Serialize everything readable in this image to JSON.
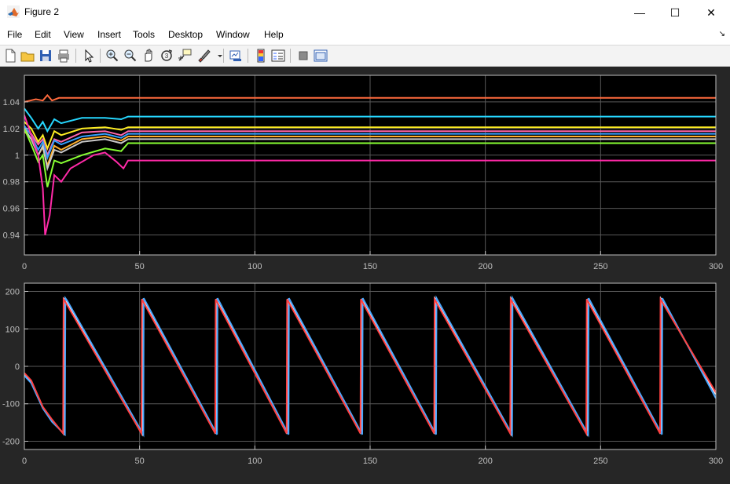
{
  "window": {
    "title": "Figure 2",
    "controls": {
      "minimize": "—",
      "maximize": "☐",
      "close": "✕"
    }
  },
  "menu": [
    "File",
    "Edit",
    "View",
    "Insert",
    "Tools",
    "Desktop",
    "Window",
    "Help"
  ],
  "toolbar": {
    "icons": [
      "new-figure-icon",
      "open-file-icon",
      "save-icon",
      "print-icon",
      "select-arrow-icon",
      "zoom-in-icon",
      "zoom-out-icon",
      "pan-hand-icon",
      "rotate-3d-icon",
      "data-cursor-icon",
      "brush-icon",
      "link-plot-icon",
      "insert-colorbar-icon",
      "insert-legend-icon",
      "hide-plot-tools-icon",
      "show-plot-tools-icon"
    ]
  },
  "colors": {
    "figure_bg": "#262626",
    "axes_bg": "#000000",
    "axis_color": "#bfbfbf",
    "grid_color": "#595959"
  },
  "chart_data": [
    {
      "type": "line",
      "title": "",
      "xlabel": "",
      "ylabel": "",
      "xlim": [
        0,
        300
      ],
      "ylim": [
        0.925,
        1.06
      ],
      "xticks": [
        0,
        50,
        100,
        150,
        200,
        250,
        300
      ],
      "xtick_labels": [
        "0",
        "50",
        "100",
        "150",
        "200",
        "250",
        "300"
      ],
      "yticks": [
        0.94,
        0.96,
        0.98,
        1,
        1.02,
        1.04
      ],
      "ytick_labels": [
        "0.94",
        "0.96",
        "0.98",
        "1",
        "1.02",
        "1.04"
      ],
      "grid": true,
      "series": [
        {
          "color": "#ff6a3d",
          "x": [
            0,
            5,
            8,
            10,
            12,
            15,
            40,
            300
          ],
          "y": [
            1.04,
            1.042,
            1.041,
            1.045,
            1.041,
            1.043,
            1.043,
            1.043
          ]
        },
        {
          "color": "#26d7ff",
          "x": [
            0,
            3,
            6,
            8,
            10,
            13,
            16,
            25,
            35,
            42,
            45,
            300
          ],
          "y": [
            1.035,
            1.028,
            1.02,
            1.025,
            1.018,
            1.027,
            1.024,
            1.028,
            1.028,
            1.027,
            1.029,
            1.029
          ]
        },
        {
          "color": "#ffee22",
          "x": [
            0,
            3,
            6,
            8,
            10,
            13,
            16,
            25,
            35,
            42,
            45,
            300
          ],
          "y": [
            1.025,
            1.02,
            1.01,
            1.015,
            1.005,
            1.018,
            1.015,
            1.02,
            1.021,
            1.019,
            1.021,
            1.021
          ]
        },
        {
          "color": "#ff66aa",
          "x": [
            0,
            3,
            6,
            8,
            10,
            13,
            16,
            25,
            35,
            42,
            45,
            300
          ],
          "y": [
            1.02,
            1.016,
            1.008,
            1.012,
            1.0,
            1.012,
            1.01,
            1.017,
            1.018,
            1.015,
            1.018,
            1.018
          ]
        },
        {
          "color": "#33a0ff",
          "x": [
            0,
            3,
            6,
            8,
            10,
            13,
            16,
            25,
            35,
            42,
            45,
            300
          ],
          "y": [
            1.022,
            1.015,
            1.004,
            1.01,
            0.998,
            1.011,
            1.008,
            1.014,
            1.016,
            1.013,
            1.016,
            1.016
          ]
        },
        {
          "color": "#ffb02e",
          "x": [
            0,
            3,
            6,
            8,
            10,
            13,
            16,
            25,
            35,
            42,
            45,
            300
          ],
          "y": [
            1.018,
            1.012,
            1.0,
            1.006,
            0.992,
            1.007,
            1.004,
            1.012,
            1.014,
            1.011,
            1.014,
            1.014
          ]
        },
        {
          "color": "#c8c8c8",
          "x": [
            0,
            3,
            6,
            8,
            10,
            13,
            16,
            25,
            35,
            42,
            45,
            300
          ],
          "y": [
            1.02,
            1.012,
            1.0,
            1.007,
            0.99,
            1.004,
            1.002,
            1.01,
            1.012,
            1.009,
            1.012,
            1.012
          ]
        },
        {
          "color": "#88ff33",
          "x": [
            0,
            3,
            6,
            8,
            10,
            13,
            16,
            25,
            35,
            42,
            45,
            300
          ],
          "y": [
            1.02,
            1.008,
            0.995,
            1.0,
            0.976,
            0.996,
            0.994,
            1.0,
            1.005,
            1.003,
            1.009,
            1.009
          ]
        },
        {
          "color": "#ff2aa8",
          "x": [
            0,
            3,
            6,
            8,
            9,
            11,
            13,
            16,
            20,
            30,
            35,
            40,
            43,
            45,
            300
          ],
          "y": [
            1.03,
            1.015,
            1.0,
            0.975,
            0.94,
            0.955,
            0.985,
            0.98,
            0.99,
            1.0,
            1.002,
            0.995,
            0.99,
            0.996,
            0.996
          ]
        }
      ]
    },
    {
      "type": "line",
      "title": "",
      "xlabel": "",
      "ylabel": "",
      "xlim": [
        0,
        300
      ],
      "ylim": [
        -222,
        222
      ],
      "xticks": [
        0,
        50,
        100,
        150,
        200,
        250,
        300
      ],
      "xtick_labels": [
        "0",
        "50",
        "100",
        "150",
        "200",
        "250",
        "300"
      ],
      "yticks": [
        -200,
        -100,
        0,
        100,
        200
      ],
      "ytick_labels": [
        "-200",
        "-100",
        "0",
        "100",
        "200"
      ],
      "grid": true,
      "series": [
        {
          "color": "#ffffff",
          "x": [
            0,
            3,
            8,
            12,
            17,
            17.2,
            18,
            51,
            51.2,
            83,
            83.2,
            114,
            114.2,
            146,
            146.2,
            178,
            178.2,
            211,
            211.2,
            244,
            244.2,
            276,
            276.2,
            300
          ],
          "y": [
            -20,
            -40,
            -110,
            -145,
            -180,
            180,
            175,
            -180,
            180,
            -180,
            180,
            -180,
            180,
            -180,
            180,
            -180,
            180,
            -180,
            180,
            -180,
            180,
            -180,
            180,
            -75
          ]
        },
        {
          "color": "#4aa8ff",
          "x": [
            0,
            3,
            8,
            12,
            17.6,
            17.8,
            18.5,
            51.6,
            51.8,
            83.6,
            83.8,
            114.6,
            114.8,
            146.6,
            146.8,
            178.6,
            178.8,
            211.6,
            211.8,
            244.6,
            244.8,
            276.6,
            276.8,
            300
          ],
          "y": [
            -25,
            -45,
            -112,
            -148,
            -182,
            182,
            176,
            -182,
            182,
            -182,
            182,
            -182,
            182,
            -182,
            182,
            -182,
            182,
            -182,
            182,
            -182,
            182,
            -182,
            182,
            -85
          ]
        },
        {
          "color": "#ff4040",
          "x": [
            0,
            3,
            8,
            12,
            16.8,
            17,
            17.6,
            50.8,
            51,
            82.8,
            83,
            113.8,
            114,
            145.8,
            146,
            177.8,
            178,
            210.8,
            211,
            243.8,
            244,
            275.8,
            276,
            300
          ],
          "y": [
            -18,
            -38,
            -108,
            -142,
            -179,
            179,
            174,
            -179,
            179,
            -179,
            179,
            -179,
            179,
            -179,
            179,
            -179,
            179,
            -179,
            179,
            -179,
            179,
            -179,
            179,
            -70
          ]
        }
      ]
    }
  ]
}
